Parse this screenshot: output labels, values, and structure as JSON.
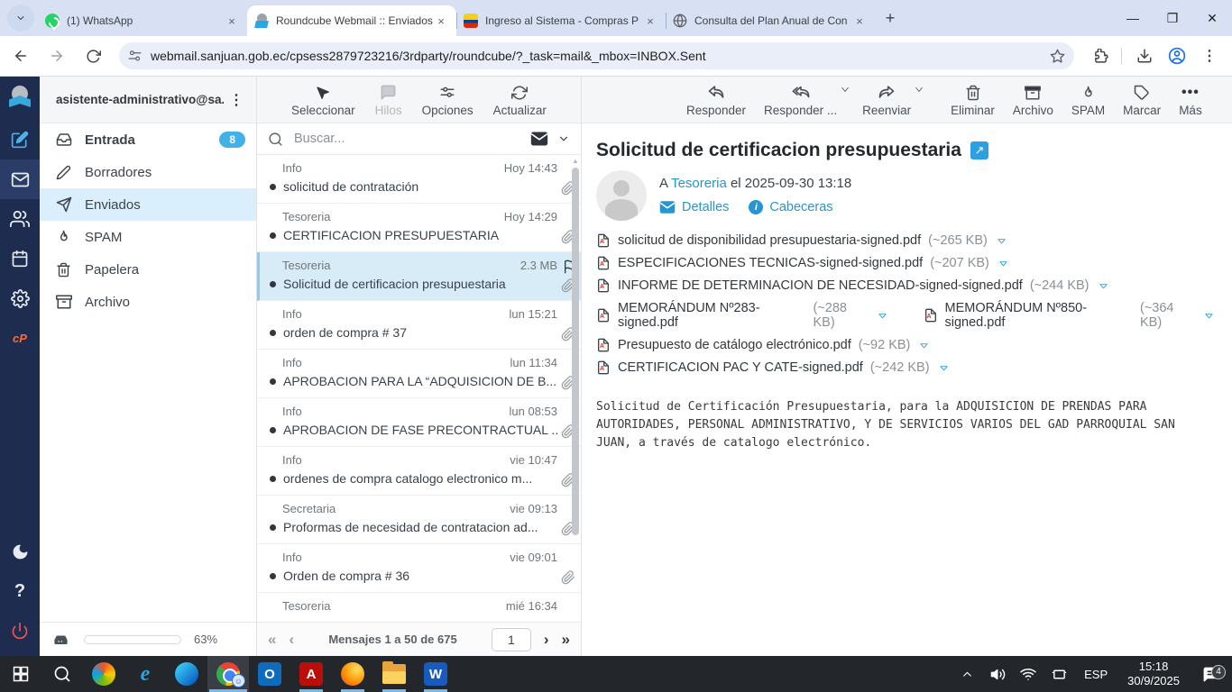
{
  "colors": {
    "accent_blue": "#2596d1",
    "rail_navy": "#1e2c4f",
    "badge_blue": "#41b1e8",
    "selected_row": "#d8ecf8",
    "cpanel_orange": "#ff6c2c",
    "power_red": "#e8574e"
  },
  "browser": {
    "tabs": [
      {
        "title": "(1) WhatsApp"
      },
      {
        "title": "Roundcube Webmail :: Enviados"
      },
      {
        "title": "Ingreso al Sistema - Compras P"
      },
      {
        "title": "Consulta del Plan Anual de Con"
      }
    ],
    "url": "webmail.sanjuan.gob.ec/cpsess2879723216/3rdparty/roundcube/?_task=mail&_mbox=INBOX.Sent"
  },
  "webmail": {
    "account": "asistente-administrativo@sa...",
    "folders": [
      {
        "label": "Entrada",
        "badge": "8"
      },
      {
        "label": "Borradores"
      },
      {
        "label": "Enviados"
      },
      {
        "label": "SPAM"
      },
      {
        "label": "Papelera"
      },
      {
        "label": "Archivo"
      }
    ],
    "list_toolbar": {
      "select": "Seleccionar",
      "threads": "Hilos",
      "options": "Opciones",
      "refresh": "Actualizar"
    },
    "search_placeholder": "Buscar...",
    "messages": [
      {
        "sender": "Info",
        "meta": "Hoy 14:43",
        "subject": "solicitud de contratación"
      },
      {
        "sender": "Tesoreria",
        "meta": "Hoy 14:29",
        "subject": "CERTIFICACION PRESUPUESTARIA"
      },
      {
        "sender": "Tesoreria",
        "meta": "2.3 MB",
        "subject": "Solicitud de certificacion presupuestaria"
      },
      {
        "sender": "Info",
        "meta": "lun 15:21",
        "subject": "orden de compra # 37"
      },
      {
        "sender": "Info",
        "meta": "lun 11:34",
        "subject": "APROBACION PARA LA “ADQUISICION DE B..."
      },
      {
        "sender": "Info",
        "meta": "lun 08:53",
        "subject": "APROBACION DE FASE PRECONTRACTUAL ..."
      },
      {
        "sender": "Info",
        "meta": "vie 10:47",
        "subject": "ordenes de compra catalogo electronico m..."
      },
      {
        "sender": "Secretaria",
        "meta": "vie 09:13",
        "subject": "Proformas de necesidad de contratacion ad..."
      },
      {
        "sender": "Info",
        "meta": "vie 09:01",
        "subject": "Orden de compra # 36"
      },
      {
        "sender": "Tesoreria",
        "meta": "mié 16:34",
        "subject": ""
      }
    ],
    "pagination": {
      "label": "Mensajes 1 a 50 de 675",
      "page": "1"
    },
    "quota": {
      "label": "63%"
    }
  },
  "mail": {
    "toolbar": {
      "reply": "Responder",
      "reply_all": "Responder ...",
      "forward": "Reenviar",
      "delete": "Eliminar",
      "archive": "Archivo",
      "spam": "SPAM",
      "mark": "Marcar",
      "more": "Más"
    },
    "subject": "Solicitud de certificacion presupuestaria",
    "to_prefix": "A",
    "recipient": "Tesoreria",
    "date_text": "el 2025-09-30 13:18",
    "details_label": "Detalles",
    "headers_label": "Cabeceras",
    "attachments": [
      {
        "name": "solicitud de disponibilidad presupuestaria-signed.pdf",
        "size": "(~265 KB)"
      },
      {
        "name": "ESPECIFICACIONES TECNICAS-signed-signed.pdf",
        "size": "(~207 KB)"
      },
      {
        "name": "INFORME DE DETERMINACION DE NECESIDAD-signed-signed.pdf",
        "size": "(~244 KB)"
      },
      {
        "name": "MEMORÁNDUM Nº283-signed.pdf",
        "size": "(~288 KB)"
      },
      {
        "name": "MEMORÁNDUM Nº850-signed.pdf",
        "size": "(~364 KB)"
      },
      {
        "name": "Presupuesto de catálogo electrónico.pdf",
        "size": "(~92 KB)"
      },
      {
        "name": "CERTIFICACION PAC Y CATE-signed.pdf",
        "size": "(~242 KB)"
      }
    ],
    "body": "Solicitud de Certificación Presupuestaria, para la ADQUISICION DE PRENDAS PARA AUTORIDADES, PERSONAL ADMINISTRATIVO, Y DE SERVICIOS VARIOS DEL GAD PARROQUIAL SAN JUAN, a través de catalogo electrónico."
  },
  "taskbar": {
    "language": "ESP",
    "time": "15:18",
    "date": "30/9/2025",
    "notification_count": "4"
  }
}
